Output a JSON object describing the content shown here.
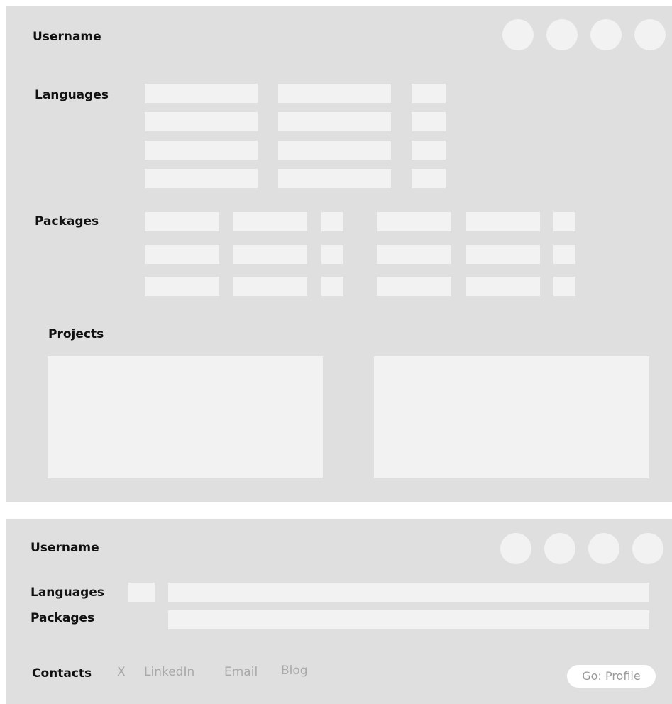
{
  "card_expanded": {
    "username": "Username",
    "icons": [
      "profile-link-icon-1",
      "profile-link-icon-2",
      "profile-link-icon-3",
      "profile-link-icon-4"
    ],
    "languages_label": "Languages",
    "packages_label": "Packages",
    "projects_label": "Projects"
  },
  "card_compact": {
    "username": "Username",
    "icons": [
      "profile-link-icon-1",
      "profile-link-icon-2",
      "profile-link-icon-3",
      "profile-link-icon-4"
    ],
    "languages_label": "Languages",
    "packages_label": "Packages",
    "contacts_label": "Contacts",
    "contacts": [
      "X",
      "LinkedIn",
      "Email",
      "Blog"
    ],
    "go_profile_label": "Go: Profile"
  }
}
